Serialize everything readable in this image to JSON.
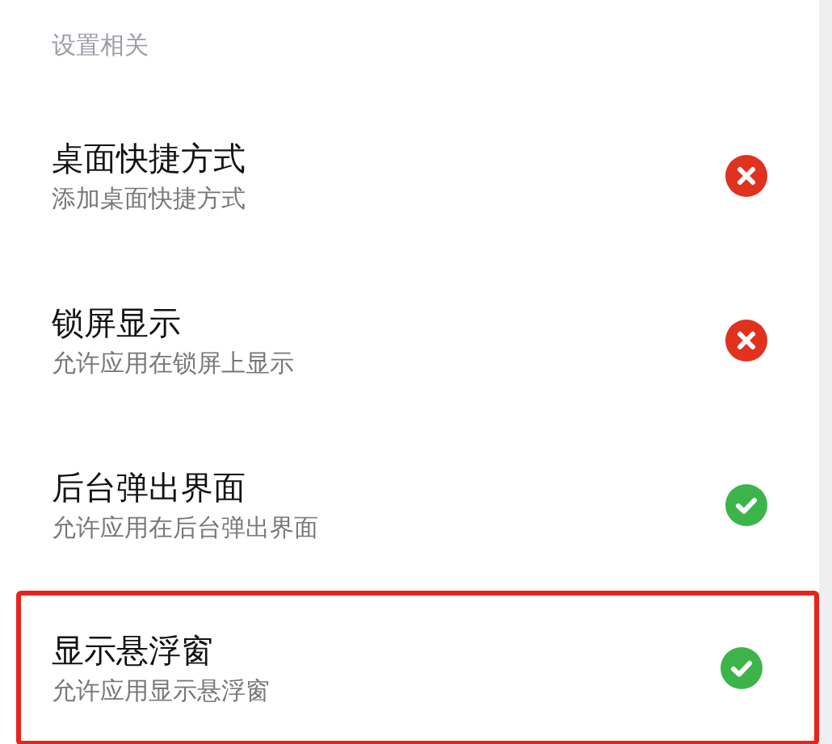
{
  "section_title": "设置相关",
  "items": [
    {
      "title": "桌面快捷方式",
      "subtitle": "添加桌面快捷方式",
      "allowed": false,
      "highlighted": false
    },
    {
      "title": "锁屏显示",
      "subtitle": "允许应用在锁屏上显示",
      "allowed": false,
      "highlighted": false
    },
    {
      "title": "后台弹出界面",
      "subtitle": "允许应用在后台弹出界面",
      "allowed": true,
      "highlighted": false
    },
    {
      "title": "显示悬浮窗",
      "subtitle": "允许应用显示悬浮窗",
      "allowed": true,
      "highlighted": true
    }
  ]
}
